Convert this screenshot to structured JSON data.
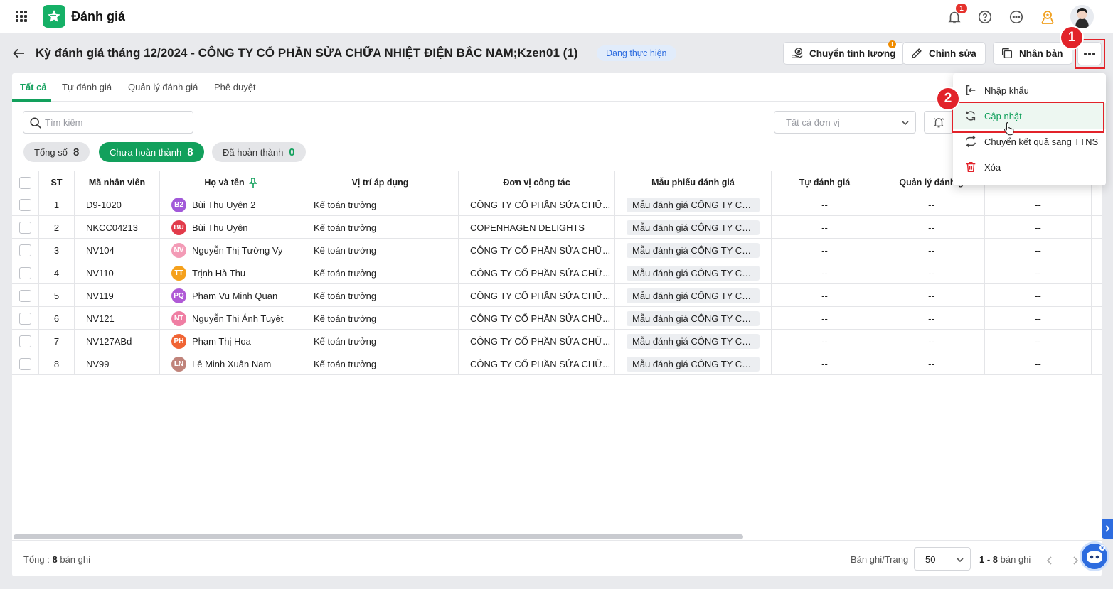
{
  "app": {
    "title": "Đánh giá",
    "notification_count": "1"
  },
  "header": {
    "title": "Kỳ đánh giá tháng 12/2024 - CÔNG TY CỔ PHẦN SỬA CHỮA NHIỆT ĐIỆN BẮC NAM;Kzen01 (1)",
    "status": "Đang thực hiện",
    "btn_salary": "Chuyển tính lương",
    "btn_edit": "Chỉnh sửa",
    "btn_copy": "Nhân bản"
  },
  "annotations": {
    "step1": "1",
    "step2": "2"
  },
  "tabs": [
    "Tất cả",
    "Tự đánh giá",
    "Quản lý đánh giá",
    "Phê duyệt"
  ],
  "search": {
    "placeholder": "Tìm kiếm"
  },
  "unit_filter": {
    "placeholder": "Tất cả đơn vị"
  },
  "chips": {
    "total_label": "Tổng số",
    "total_count": "8",
    "pending_label": "Chưa hoàn thành",
    "pending_count": "8",
    "done_label": "Đã hoàn thành",
    "done_count": "0"
  },
  "columns": [
    "ST",
    "Mã nhân viên",
    "Họ và tên",
    "Vị trí áp dụng",
    "Đơn vị công tác",
    "Mẫu phiếu đánh giá",
    "Tự đánh giá",
    "Quản lý đánh g"
  ],
  "rows": [
    {
      "stt": "1",
      "code": "D9-1020",
      "initials": "B2",
      "color": "#a259d9",
      "name": "Bùi Thu Uyên 2",
      "position": "Kế toán trưởng",
      "unit": "CÔNG TY CỔ PHẦN SỬA CHỮ...",
      "template": "Mẫu đánh giá CÔNG TY CỔ ...",
      "self": "--",
      "manager": "--",
      "approve": "--"
    },
    {
      "stt": "2",
      "code": "NKCC04213",
      "initials": "BU",
      "color": "#e23b4a",
      "name": "Bùi Thu Uyên",
      "position": "Kế toán trưởng",
      "unit": "COPENHAGEN DELIGHTS",
      "template": "Mẫu đánh giá CÔNG TY CỔ ...",
      "self": "--",
      "manager": "--",
      "approve": "--"
    },
    {
      "stt": "3",
      "code": "NV104",
      "initials": "NV",
      "color": "#f39bb6",
      "name": "Nguyễn Thị Tường Vy",
      "position": "Kế toán trưởng",
      "unit": "CÔNG TY CỔ PHẦN SỬA CHỮ...",
      "template": "Mẫu đánh giá CÔNG TY CỔ ...",
      "self": "--",
      "manager": "--",
      "approve": "--"
    },
    {
      "stt": "4",
      "code": "NV110",
      "initials": "TT",
      "color": "#f5a11c",
      "name": "Trịnh Hà Thu",
      "position": "Kế toán trưởng",
      "unit": "CÔNG TY CỔ PHẦN SỬA CHỮ...",
      "template": "Mẫu đánh giá CÔNG TY CỔ ...",
      "self": "--",
      "manager": "--",
      "approve": "--"
    },
    {
      "stt": "5",
      "code": "NV119",
      "initials": "PQ",
      "color": "#b05ad6",
      "name": "Pham Vu Minh Quan",
      "position": "Kế toán trưởng",
      "unit": "CÔNG TY CỔ PHẦN SỬA CHỮ...",
      "template": "Mẫu đánh giá CÔNG TY CỔ ...",
      "self": "--",
      "manager": "--",
      "approve": "--"
    },
    {
      "stt": "6",
      "code": "NV121",
      "initials": "NT",
      "color": "#ef7ea3",
      "name": "Nguyễn Thị Ánh Tuyết",
      "position": "Kế toán trưởng",
      "unit": "CÔNG TY CỔ PHẦN SỬA CHỮ...",
      "template": "Mẫu đánh giá CÔNG TY CỔ ...",
      "self": "--",
      "manager": "--",
      "approve": "--"
    },
    {
      "stt": "7",
      "code": "NV127ABd",
      "initials": "PH",
      "color": "#f06434",
      "name": "Phạm Thị Hoa",
      "position": "Kế toán trưởng",
      "unit": "CÔNG TY CỔ PHẦN SỬA CHỮ...",
      "template": "Mẫu đánh giá CÔNG TY CỔ ...",
      "self": "--",
      "manager": "--",
      "approve": "--"
    },
    {
      "stt": "8",
      "code": "NV99",
      "initials": "LN",
      "color": "#c0837a",
      "name": "Lê Minh Xuân Nam",
      "position": "Kế toán trưởng",
      "unit": "CÔNG TY CỔ PHẦN SỬA CHỮ...",
      "template": "Mẫu đánh giá CÔNG TY CỔ ...",
      "self": "--",
      "manager": "--",
      "approve": "--"
    }
  ],
  "footer": {
    "total_label": "Tổng :",
    "total_count": "8",
    "total_suffix": "bản ghi",
    "per_page_label": "Bản ghi/Trang",
    "per_page": "50",
    "range": "1 - 8",
    "range_suffix": "bản ghi"
  },
  "menu": [
    "Nhập khẩu",
    "Cập nhật",
    "Chuyển kết quả sang TTNS",
    "Xóa"
  ],
  "colors": {
    "accent": "#12a05c",
    "status_bg": "#e1ecfb",
    "annotation": "#e2232a"
  }
}
